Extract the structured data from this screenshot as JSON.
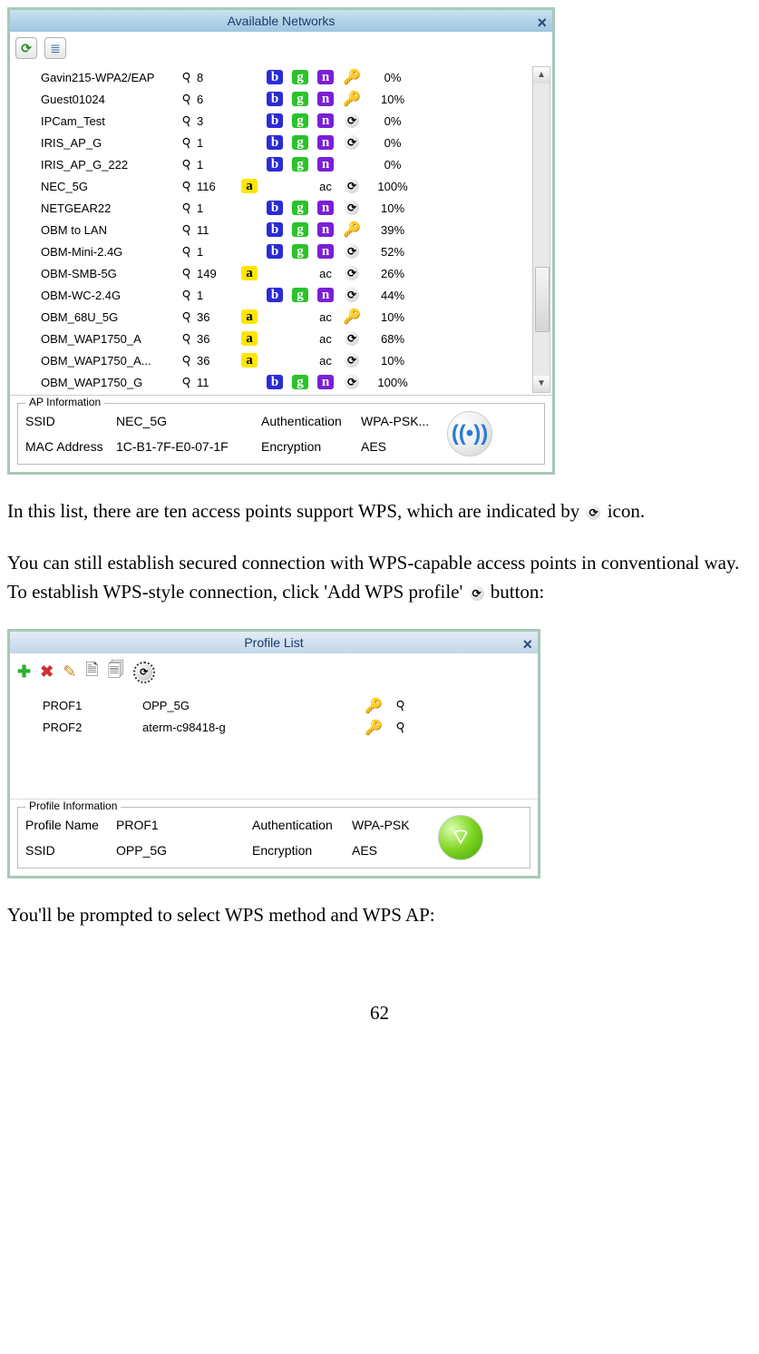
{
  "win1": {
    "title": "Available Networks",
    "rows": [
      {
        "ssid": "Gavin215-WPA2/EAP",
        "ch": "8",
        "a": false,
        "b": true,
        "g": true,
        "n": true,
        "ac": false,
        "sec": "key",
        "pct": "0%"
      },
      {
        "ssid": "Guest01024",
        "ch": "6",
        "a": false,
        "b": true,
        "g": true,
        "n": true,
        "ac": false,
        "sec": "key",
        "pct": "10%"
      },
      {
        "ssid": "IPCam_Test",
        "ch": "3",
        "a": false,
        "b": true,
        "g": true,
        "n": true,
        "ac": false,
        "sec": "wps",
        "pct": "0%"
      },
      {
        "ssid": "IRIS_AP_G",
        "ch": "1",
        "a": false,
        "b": true,
        "g": true,
        "n": true,
        "ac": false,
        "sec": "wps",
        "pct": "0%"
      },
      {
        "ssid": "IRIS_AP_G_222",
        "ch": "1",
        "a": false,
        "b": true,
        "g": true,
        "n": true,
        "ac": false,
        "sec": "",
        "pct": "0%"
      },
      {
        "ssid": "NEC_5G",
        "ch": "116",
        "a": true,
        "b": false,
        "g": false,
        "n": false,
        "ac": true,
        "sec": "wps",
        "pct": "100%"
      },
      {
        "ssid": "NETGEAR22",
        "ch": "1",
        "a": false,
        "b": true,
        "g": true,
        "n": true,
        "ac": false,
        "sec": "wps",
        "pct": "10%"
      },
      {
        "ssid": "OBM to LAN",
        "ch": "11",
        "a": false,
        "b": true,
        "g": true,
        "n": true,
        "ac": false,
        "sec": "key",
        "pct": "39%"
      },
      {
        "ssid": "OBM-Mini-2.4G",
        "ch": "1",
        "a": false,
        "b": true,
        "g": true,
        "n": true,
        "ac": false,
        "sec": "wps",
        "pct": "52%"
      },
      {
        "ssid": "OBM-SMB-5G",
        "ch": "149",
        "a": true,
        "b": false,
        "g": false,
        "n": false,
        "ac": true,
        "sec": "wps",
        "pct": "26%"
      },
      {
        "ssid": "OBM-WC-2.4G",
        "ch": "1",
        "a": false,
        "b": true,
        "g": true,
        "n": true,
        "ac": false,
        "sec": "wps",
        "pct": "44%"
      },
      {
        "ssid": "OBM_68U_5G",
        "ch": "36",
        "a": true,
        "b": false,
        "g": false,
        "n": false,
        "ac": true,
        "sec": "key",
        "pct": "10%"
      },
      {
        "ssid": "OBM_WAP1750_A",
        "ch": "36",
        "a": true,
        "b": false,
        "g": false,
        "n": false,
        "ac": true,
        "sec": "wps",
        "pct": "68%"
      },
      {
        "ssid": "OBM_WAP1750_A...",
        "ch": "36",
        "a": true,
        "b": false,
        "g": false,
        "n": false,
        "ac": true,
        "sec": "wps",
        "pct": "10%"
      },
      {
        "ssid": "OBM_WAP1750_G",
        "ch": "11",
        "a": false,
        "b": true,
        "g": true,
        "n": true,
        "ac": false,
        "sec": "wps",
        "pct": "100%"
      }
    ],
    "info": {
      "legend": "AP Information",
      "l_ssid": "SSID",
      "v_ssid": "NEC_5G",
      "l_auth": "Authentication",
      "v_auth": "WPA-PSK...",
      "l_mac": "MAC Address",
      "v_mac": "1C-B1-7F-E0-07-1F",
      "l_enc": "Encryption",
      "v_enc": "AES"
    }
  },
  "text1": "In this list, there are ten access points support WPS, which are indicated by ",
  "text2": " icon.",
  "text3": "You can still establish secured connection with WPS-capable access points in conventional way. To establish WPS-style connection, click 'Add WPS profile' ",
  "text4": " button:",
  "win2": {
    "title": "Profile List",
    "rows": [
      {
        "name": "PROF1",
        "ssid": "OPP_5G"
      },
      {
        "name": "PROF2",
        "ssid": "aterm-c98418-g"
      }
    ],
    "info": {
      "legend": "Profile Information",
      "l_pn": "Profile Name",
      "v_pn": "PROF1",
      "l_auth": "Authentication",
      "v_auth": "WPA-PSK",
      "l_ssid": "SSID",
      "v_ssid": "OPP_5G",
      "l_enc": "Encryption",
      "v_enc": "AES"
    }
  },
  "text5": "You'll be prompted to select WPS method and WPS AP:",
  "pagenum": "62",
  "chips": {
    "a": "a",
    "b": "b",
    "g": "g",
    "n": "n",
    "ac": "ac"
  },
  "wps_glyph": "⟳"
}
